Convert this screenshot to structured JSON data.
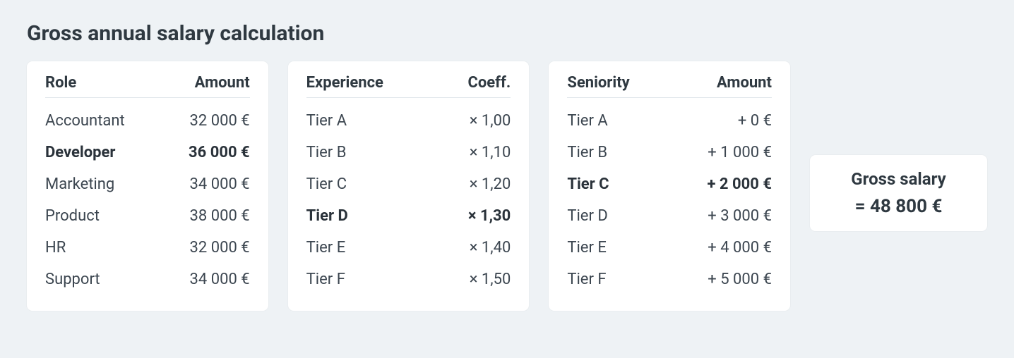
{
  "title": "Gross annual salary calculation",
  "role_card": {
    "col1": "Role",
    "col2": "Amount",
    "rows": [
      {
        "label": "Accountant",
        "value": "32 000 €",
        "selected": false
      },
      {
        "label": "Developer",
        "value": "36 000 €",
        "selected": true
      },
      {
        "label": "Marketing",
        "value": "34 000 €",
        "selected": false
      },
      {
        "label": "Product",
        "value": "38 000 €",
        "selected": false
      },
      {
        "label": "HR",
        "value": "32 000 €",
        "selected": false
      },
      {
        "label": "Support",
        "value": "34 000 €",
        "selected": false
      }
    ]
  },
  "experience_card": {
    "col1": "Experience",
    "col2": "Coeff.",
    "rows": [
      {
        "label": "Tier A",
        "value": "× 1,00",
        "selected": false
      },
      {
        "label": "Tier B",
        "value": "× 1,10",
        "selected": false
      },
      {
        "label": "Tier C",
        "value": "× 1,20",
        "selected": false
      },
      {
        "label": "Tier D",
        "value": "× 1,30",
        "selected": true
      },
      {
        "label": "Tier E",
        "value": "× 1,40",
        "selected": false
      },
      {
        "label": "Tier F",
        "value": "× 1,50",
        "selected": false
      }
    ]
  },
  "seniority_card": {
    "col1": "Seniority",
    "col2": "Amount",
    "rows": [
      {
        "label": "Tier A",
        "value": "+ 0 €",
        "selected": false
      },
      {
        "label": "Tier B",
        "value": "+ 1 000 €",
        "selected": false
      },
      {
        "label": "Tier C",
        "value": "+ 2 000 €",
        "selected": true
      },
      {
        "label": "Tier D",
        "value": "+ 3 000 €",
        "selected": false
      },
      {
        "label": "Tier E",
        "value": "+ 4 000 €",
        "selected": false
      },
      {
        "label": "Tier F",
        "value": "+ 5 000 €",
        "selected": false
      }
    ]
  },
  "result": {
    "label": "Gross salary",
    "value": "= 48 800 €"
  }
}
